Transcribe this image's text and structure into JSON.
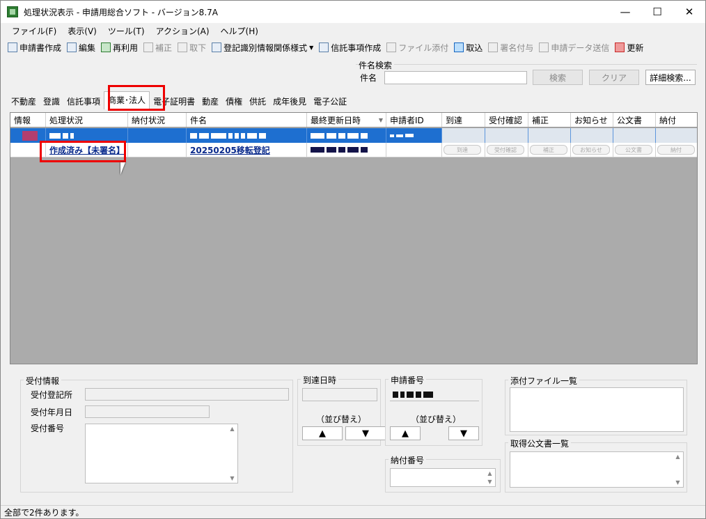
{
  "window": {
    "title": "処理状況表示 - 申請用総合ソフト - バージョン8.7A",
    "minimize": "—",
    "maximize": "☐",
    "close": "✕"
  },
  "menu": [
    "ファイル(F)",
    "表示(V)",
    "ツール(T)",
    "アクション(A)",
    "ヘルプ(H)"
  ],
  "toolbar": [
    {
      "label": "申請書作成",
      "icon": "document-create-icon",
      "enabled": true
    },
    {
      "label": "編集",
      "icon": "edit-icon",
      "enabled": true
    },
    {
      "label": "再利用",
      "icon": "reuse-icon",
      "enabled": true
    },
    {
      "label": "補正",
      "icon": "correction-icon",
      "enabled": false
    },
    {
      "label": "取下",
      "icon": "withdraw-icon",
      "enabled": false
    },
    {
      "label": "登記識別情報関係様式",
      "icon": "registration-form-icon",
      "enabled": true,
      "dropdown": "▼"
    },
    {
      "label": "信託事項作成",
      "icon": "trust-document-icon",
      "enabled": true
    },
    {
      "label": "ファイル添付",
      "icon": "attach-file-icon",
      "enabled": false
    },
    {
      "label": "取込",
      "icon": "import-icon",
      "enabled": true
    },
    {
      "label": "署名付与",
      "icon": "sign-icon",
      "enabled": false
    },
    {
      "label": "申請データ送信",
      "icon": "send-icon",
      "enabled": false
    },
    {
      "label": "更新",
      "icon": "refresh-icon",
      "enabled": true
    }
  ],
  "search": {
    "legend": "件名検索",
    "label": "件名",
    "value": "",
    "search_button": "検索",
    "clear_button": "クリア",
    "advanced_button": "詳細検索..."
  },
  "tabs": [
    {
      "label": "不動産",
      "active": false
    },
    {
      "label": "登識",
      "active": false
    },
    {
      "label": "信託事項",
      "active": false
    },
    {
      "label": "商業･法人",
      "active": true
    },
    {
      "label": "電子証明書",
      "active": false
    },
    {
      "label": "動産",
      "active": false
    },
    {
      "label": "債権",
      "active": false
    },
    {
      "label": "供託",
      "active": false
    },
    {
      "label": "成年後見",
      "active": false
    },
    {
      "label": "電子公証",
      "active": false
    }
  ],
  "grid": {
    "columns": [
      "情報",
      "処理状況",
      "納付状況",
      "件名",
      "最終更新日時",
      "申請者ID",
      "到達",
      "受付確認",
      "補正",
      "お知らせ",
      "公文書",
      "納付"
    ],
    "rows": [
      {
        "selected": true,
        "status": "",
        "subject": "",
        "updated": "",
        "applicant_id": ""
      },
      {
        "selected": false,
        "status": "作成済み【未署名】",
        "subject": "20250205移転登記",
        "updated": "",
        "applicant_id": "",
        "buttons": [
          "到達",
          "受付確認",
          "補正",
          "お知らせ",
          "公文書",
          "納付"
        ]
      }
    ]
  },
  "reception": {
    "legend": "受付情報",
    "office_label": "受付登記所",
    "date_label": "受付年月日",
    "number_label": "受付番号",
    "office_value": "",
    "date_value": ""
  },
  "arrival": {
    "legend": "到達日時",
    "sort_label": "（並び替え）",
    "up": "▲",
    "down": "▼"
  },
  "application_number": {
    "legend": "申請番号",
    "sort_label": "（並び替え）",
    "up": "▲",
    "down": "▼"
  },
  "payment_number": {
    "legend": "納付番号"
  },
  "attached_files": {
    "legend": "添付ファイル一覧"
  },
  "acquired_docs": {
    "legend": "取得公文書一覧"
  },
  "status_bar": "全部で2件あります。"
}
